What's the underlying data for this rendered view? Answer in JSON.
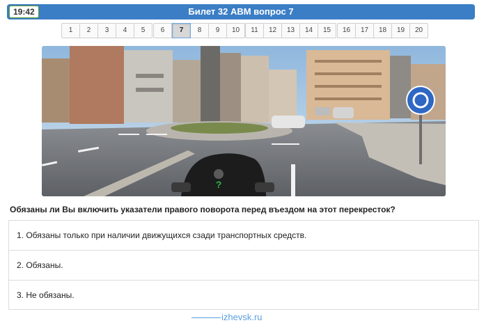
{
  "header": {
    "timer": "19:42",
    "title": "Билет 32 ABM вопрос 7",
    "accent_color": "#3b7ec6"
  },
  "pager": {
    "groups": [
      [
        "1",
        "2",
        "3",
        "4",
        "5"
      ],
      [
        "6",
        "7",
        "8",
        "9",
        "10"
      ],
      [
        "11",
        "12",
        "13",
        "14",
        "15"
      ],
      [
        "16",
        "17",
        "18",
        "19",
        "20"
      ]
    ],
    "active": "7"
  },
  "photo": {
    "alt_description": "",
    "help_marker": "?"
  },
  "question": {
    "text": "Обязаны ли Вы включить указатели правого поворота перед въездом на этот перекресток?"
  },
  "answers": [
    {
      "label": "1. Обязаны только при наличии движущихся сзади транспортных средств."
    },
    {
      "label": "2. Обязаны."
    },
    {
      "label": "3. Не обязаны."
    }
  ],
  "footer": {
    "link_text": "izhevsk.ru"
  }
}
